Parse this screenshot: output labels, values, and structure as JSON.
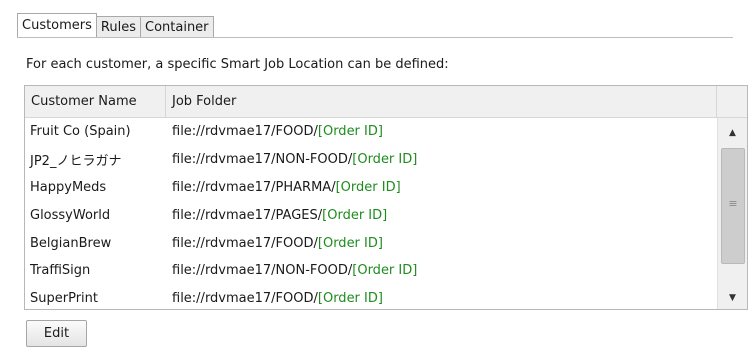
{
  "tabs": [
    {
      "label": "Customers",
      "active": true
    },
    {
      "label": "Rules",
      "active": false
    },
    {
      "label": "Container",
      "active": false
    }
  ],
  "description": "For each customer, a specific Smart Job Location can be defined:",
  "table": {
    "columns": [
      "Customer Name",
      "Job Folder"
    ],
    "rows": [
      {
        "customer": "Fruit Co (Spain)",
        "path": "file://rdvmae17/FOOD/",
        "token": "[Order ID]"
      },
      {
        "customer": "JP2_ノヒラガナ",
        "path": "file://rdvmae17/NON-FOOD/",
        "token": "[Order ID]"
      },
      {
        "customer": "HappyMeds",
        "path": "file://rdvmae17/PHARMA/",
        "token": "[Order ID]"
      },
      {
        "customer": "GlossyWorld",
        "path": "file://rdvmae17/PAGES/",
        "token": "[Order ID]"
      },
      {
        "customer": "BelgianBrew",
        "path": "file://rdvmae17/FOOD/",
        "token": "[Order ID]"
      },
      {
        "customer": "TraffiSign",
        "path": "file://rdvmae17/NON-FOOD/",
        "token": "[Order ID]"
      },
      {
        "customer": "SuperPrint",
        "path": "file://rdvmae17/FOOD/",
        "token": "[Order ID]"
      }
    ]
  },
  "scrollbar": {
    "up_icon": "▲",
    "down_icon": "▼",
    "grip": "≡"
  },
  "buttons": {
    "edit": "Edit"
  },
  "colors": {
    "token": "#1e8c1e"
  }
}
